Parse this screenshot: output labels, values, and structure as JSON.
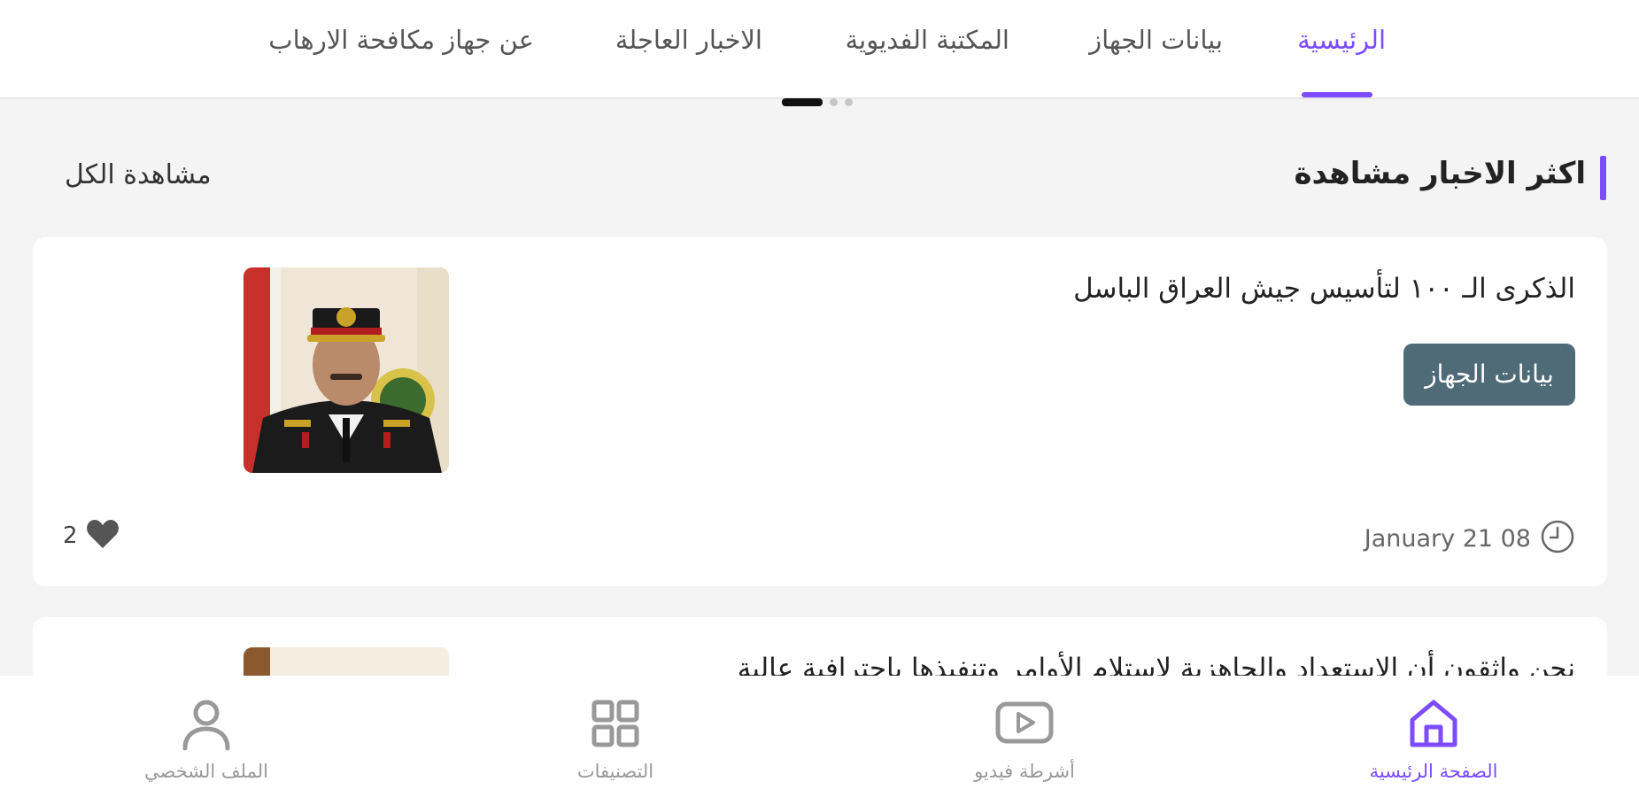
{
  "top_nav": {
    "tabs": [
      {
        "label": "الرئيسية"
      },
      {
        "label": "بيانات الجهاز"
      },
      {
        "label": "المكتبة الفديوية"
      },
      {
        "label": "الاخبار العاجلة"
      },
      {
        "label": "عن جهاز مكافحة الارهاب"
      }
    ],
    "active_tab": 0,
    "pager_dots": 3,
    "pager_active": 0
  },
  "section": {
    "title": "اكثر الاخبار مشاهدة",
    "view_all": "مشاهدة الكل"
  },
  "news": [
    {
      "title": "الذكرى الـ ١٠٠ لتأسيس جيش العراق الباسل",
      "category": "بيانات الجهاز",
      "date": "January 21 08",
      "likes": "2"
    },
    {
      "title": "نحن واثقون أن الاستعداد والجاهزية لاستلام الأوامر وتنفيذها باحترافية عالية"
    }
  ],
  "bottom_nav": {
    "items": [
      {
        "label": "الصفحة الرئيسية",
        "icon": "home-icon"
      },
      {
        "label": "أشرطة فيديو",
        "icon": "video-icon"
      },
      {
        "label": "التصنيفات",
        "icon": "grid-icon"
      },
      {
        "label": "الملف الشخصي",
        "icon": "user-icon"
      }
    ],
    "active": 0
  },
  "colors": {
    "accent": "#7b4dff",
    "category_button": "#4f6b78",
    "background": "#f4f4f4"
  }
}
